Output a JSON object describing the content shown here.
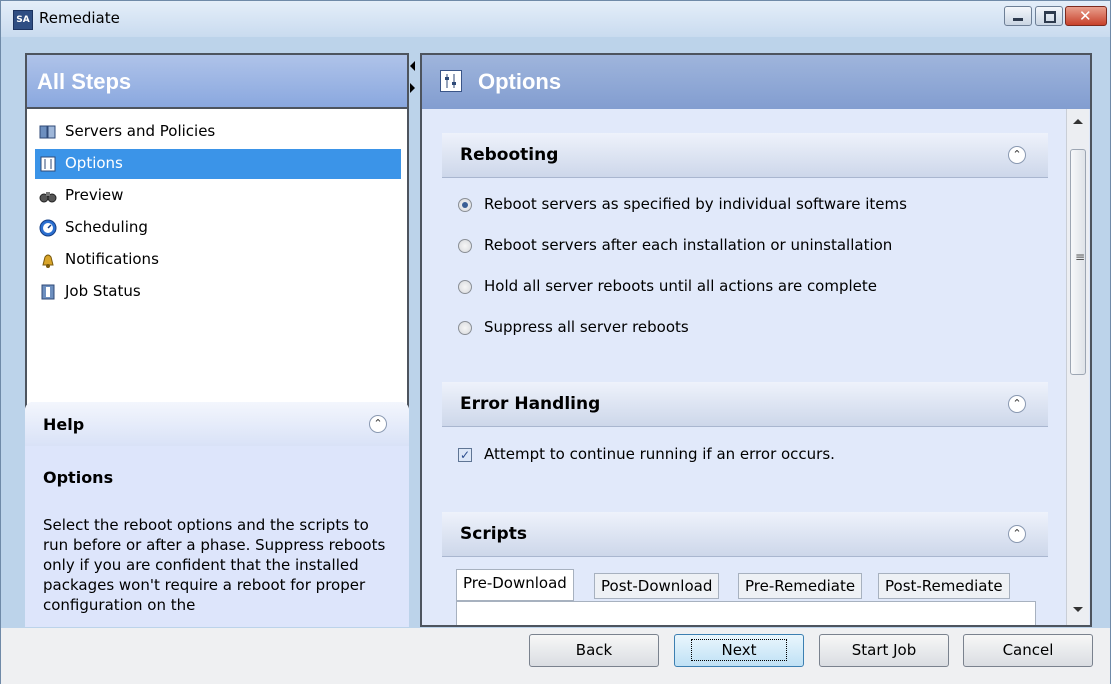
{
  "window": {
    "title": "Remediate",
    "app_icon": "SA"
  },
  "left": {
    "steps_title": "All Steps",
    "steps": [
      {
        "label": "Servers and Policies",
        "icon": "servers-icon",
        "selected": false
      },
      {
        "label": "Options",
        "icon": "options-icon",
        "selected": true
      },
      {
        "label": "Preview",
        "icon": "preview-icon",
        "selected": false
      },
      {
        "label": "Scheduling",
        "icon": "clock-icon",
        "selected": false
      },
      {
        "label": "Notifications",
        "icon": "bell-icon",
        "selected": false
      },
      {
        "label": "Job Status",
        "icon": "job-status-icon",
        "selected": false
      }
    ],
    "help": {
      "title": "Help",
      "heading": "Options",
      "body": "Select the reboot options and the scripts to run before or after a phase. Suppress reboots only if you are confident that the installed packages won't require a reboot for proper configuration on the"
    }
  },
  "right": {
    "title": "Options",
    "rebooting": {
      "title": "Rebooting",
      "options": [
        {
          "label": "Reboot servers as specified by individual software items",
          "checked": true
        },
        {
          "label": "Reboot servers after each installation or uninstallation",
          "checked": false
        },
        {
          "label": "Hold all server reboots until all actions are complete",
          "checked": false
        },
        {
          "label": "Suppress all server reboots",
          "checked": false
        }
      ]
    },
    "error_handling": {
      "title": "Error Handling",
      "continue_label": "Attempt to continue running if an error occurs.",
      "continue_checked": true
    },
    "scripts": {
      "title": "Scripts",
      "tabs": [
        "Pre-Download",
        "Post-Download",
        "Pre-Remediate",
        "Post-Remediate"
      ],
      "active_tab": "Pre-Download"
    }
  },
  "buttons": {
    "back": "Back",
    "next": "Next",
    "start_job": "Start Job",
    "cancel": "Cancel"
  },
  "colors": {
    "selection": "#3b94e8",
    "header_blue": "#8aa8df",
    "panel_bg": "#dfe8f9"
  }
}
